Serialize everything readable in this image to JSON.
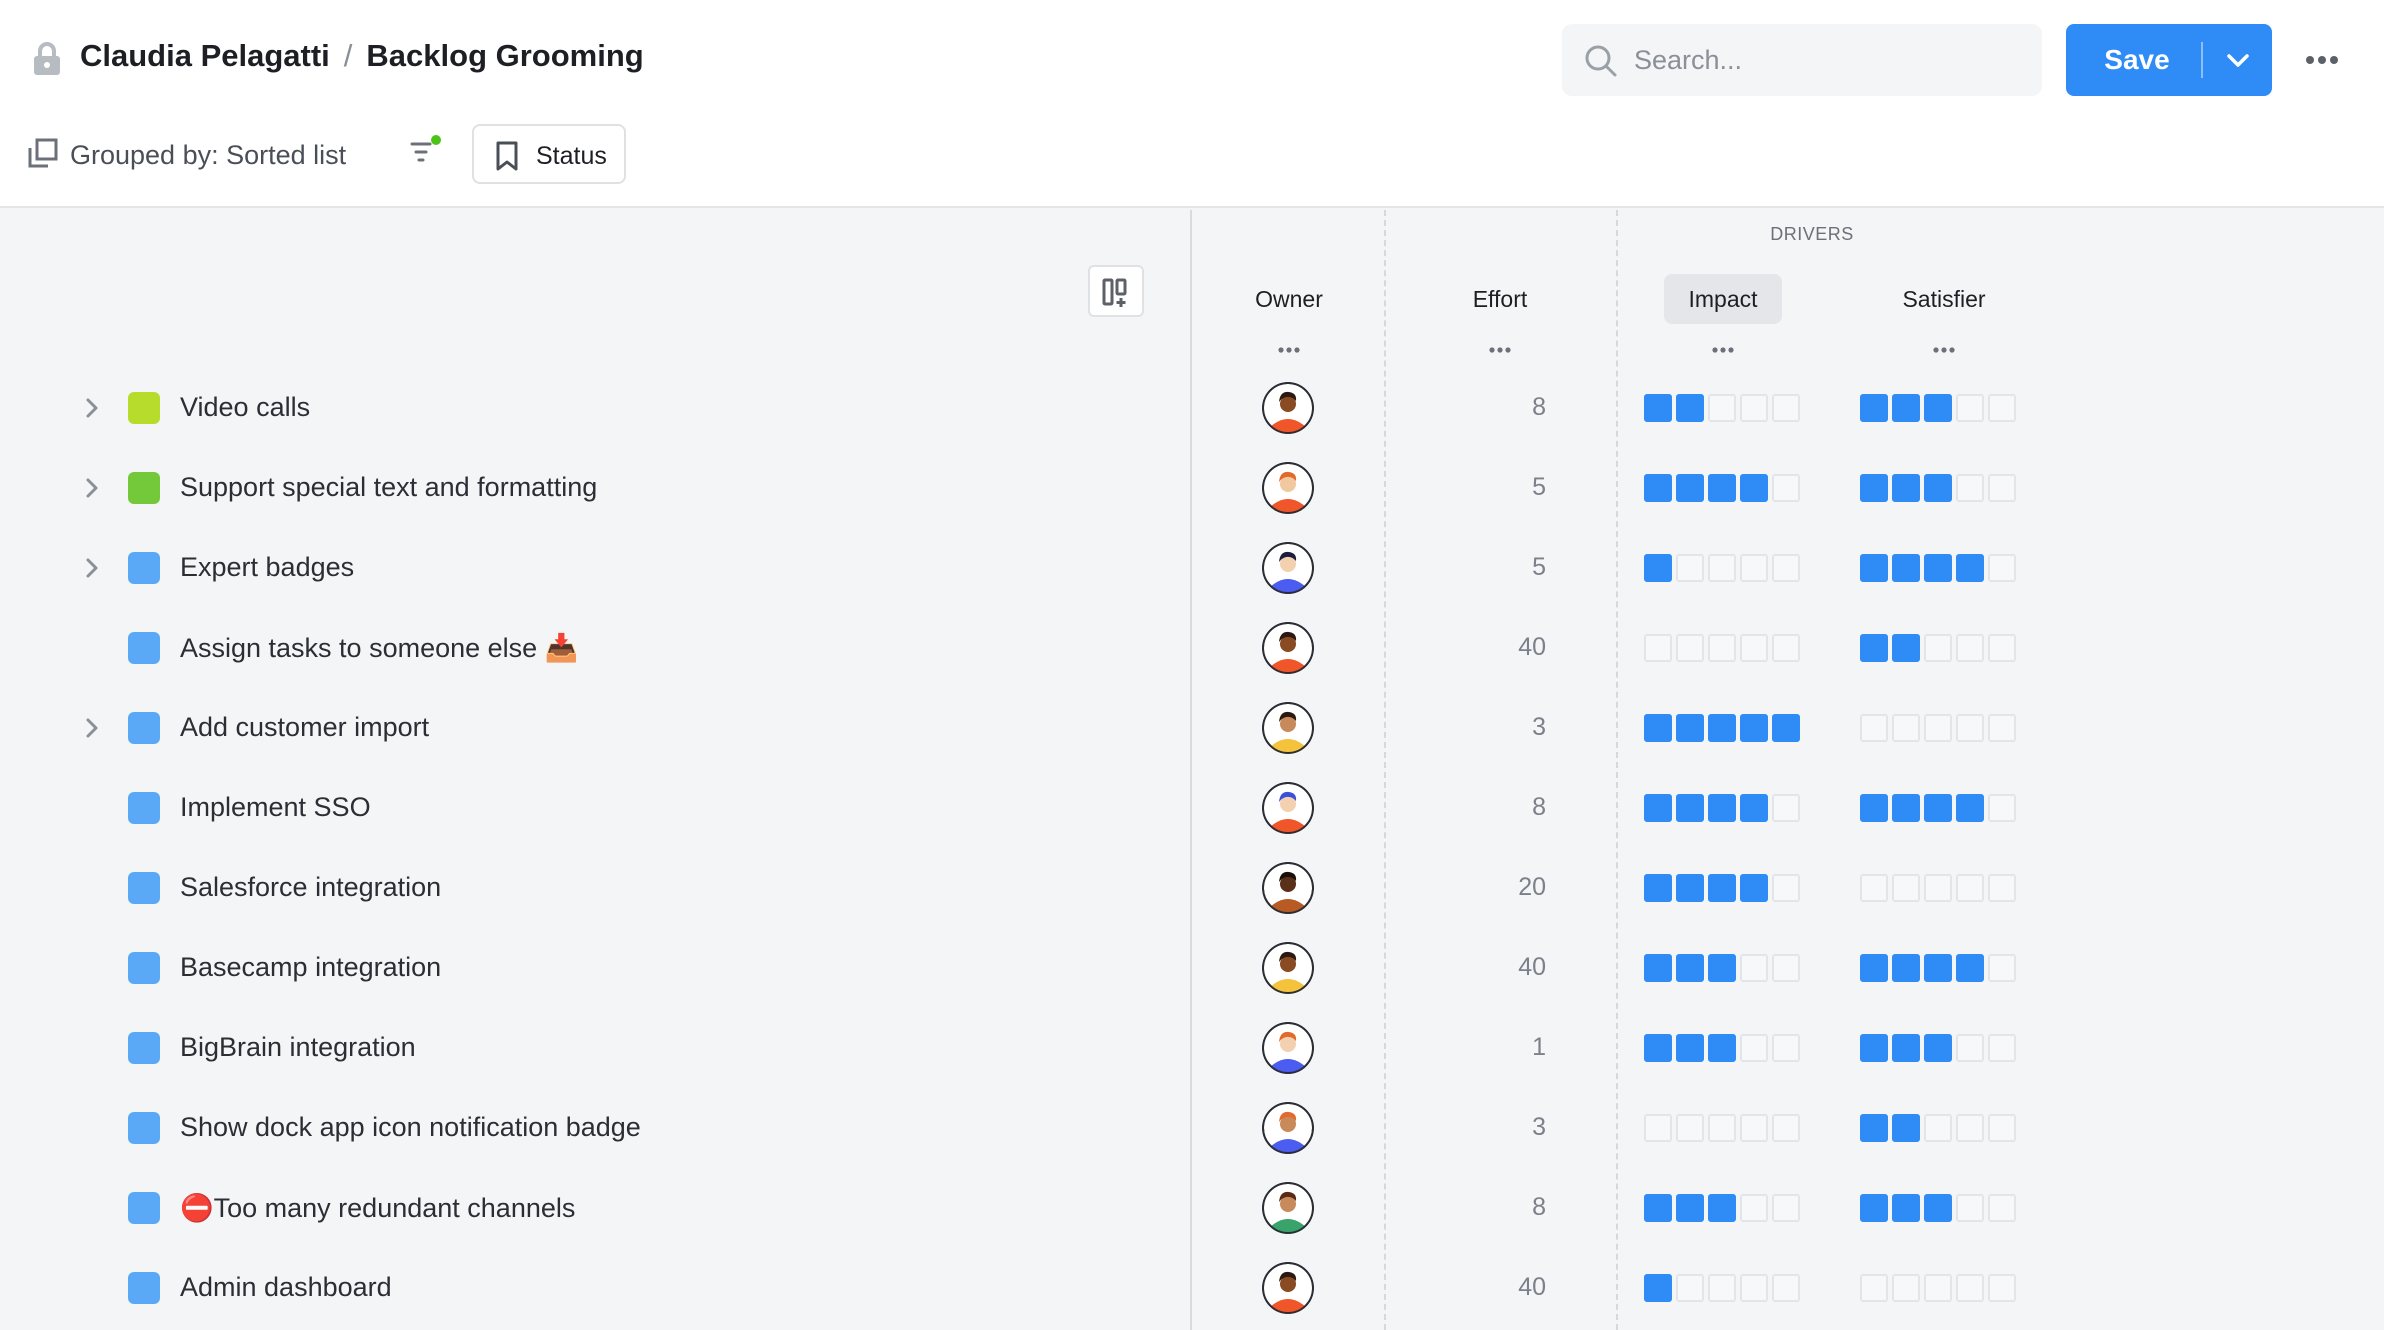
{
  "header": {
    "owner": "Claudia Pelagatti",
    "separator": "/",
    "view_name": "Backlog Grooming",
    "search_placeholder": "Search...",
    "save_label": "Save",
    "grouped_by": "Grouped by: Sorted list",
    "status_button": "Status"
  },
  "icons": {
    "lock": "lock-icon",
    "search": "search-icon",
    "save_menu": "chevron-down-icon",
    "more": "more-horizontal-icon",
    "grouping": "grouping-icon",
    "filter": "filter-icon",
    "bookmark": "bookmark-icon",
    "column_options": "column-options-icon"
  },
  "colors": {
    "accent": "#2f8cf6",
    "filter_indicator": "#4cc417",
    "lime": "#b7dc2b",
    "green": "#74c93a",
    "blue": "#5aa9f7"
  },
  "columns": {
    "drivers_group": "DRIVERS",
    "owner": "Owner",
    "effort": "Effort",
    "impact": "Impact",
    "satisfier": "Satisfier",
    "active_column": "Impact"
  },
  "rows": [
    {
      "title": "Video calls",
      "expandable": true,
      "color": "#b7dc2b",
      "effort": "8",
      "impact": 2,
      "satisfier": 3,
      "avatar": {
        "skin": "#8a4a22",
        "hair": "#2a1a12",
        "shirt": "#f0562a"
      }
    },
    {
      "title": "Support special text and formatting",
      "expandable": true,
      "color": "#74c93a",
      "effort": "5",
      "impact": 4,
      "satisfier": 3,
      "avatar": {
        "skin": "#f0c9a0",
        "hair": "#e26a2c",
        "shirt": "#f0562a"
      }
    },
    {
      "title": "Expert badges",
      "expandable": true,
      "color": "#5aa9f7",
      "effort": "5",
      "impact": 1,
      "satisfier": 4,
      "avatar": {
        "skin": "#f2d0b0",
        "hair": "#1d1f3a",
        "shirt": "#4b5cf0"
      }
    },
    {
      "title": "Assign tasks to someone else 📥",
      "expandable": false,
      "color": "#5aa9f7",
      "effort": "40",
      "impact": 0,
      "satisfier": 2,
      "avatar": {
        "skin": "#8a4a22",
        "hair": "#2a1a12",
        "shirt": "#f0562a"
      }
    },
    {
      "title": "Add customer import",
      "expandable": true,
      "color": "#5aa9f7",
      "effort": "3",
      "impact": 5,
      "satisfier": 0,
      "avatar": {
        "skin": "#c88a5a",
        "hair": "#2a1a12",
        "shirt": "#f5c33b"
      }
    },
    {
      "title": "Implement SSO",
      "expandable": false,
      "color": "#5aa9f7",
      "effort": "8",
      "impact": 4,
      "satisfier": 4,
      "avatar": {
        "skin": "#f2d0b0",
        "hair": "#3b4fd8",
        "shirt": "#f0562a"
      }
    },
    {
      "title": "Salesforce integration",
      "expandable": false,
      "color": "#5aa9f7",
      "effort": "20",
      "impact": 4,
      "satisfier": 0,
      "avatar": {
        "skin": "#5a3018",
        "hair": "#1a100a",
        "shirt": "#b85a24"
      }
    },
    {
      "title": "Basecamp integration",
      "expandable": false,
      "color": "#5aa9f7",
      "effort": "40",
      "impact": 3,
      "satisfier": 4,
      "avatar": {
        "skin": "#8a4a22",
        "hair": "#2a1a12",
        "shirt": "#f5c33b"
      }
    },
    {
      "title": "BigBrain integration",
      "expandable": false,
      "color": "#5aa9f7",
      "effort": "1",
      "impact": 3,
      "satisfier": 3,
      "avatar": {
        "skin": "#f2d0b0",
        "hair": "#e26a2c",
        "shirt": "#4b5cf0"
      }
    },
    {
      "title": "Show dock app icon notification badge",
      "expandable": false,
      "color": "#5aa9f7",
      "effort": "3",
      "impact": 0,
      "satisfier": 2,
      "avatar": {
        "skin": "#c88a5a",
        "hair": "#e26a2c",
        "shirt": "#4b5cf0"
      }
    },
    {
      "title": "⛔Too many redundant channels",
      "expandable": false,
      "color": "#5aa9f7",
      "effort": "8",
      "impact": 3,
      "satisfier": 3,
      "avatar": {
        "skin": "#c88a5a",
        "hair": "#5a2a14",
        "shirt": "#3aa36b"
      }
    },
    {
      "title": "Admin dashboard",
      "expandable": false,
      "color": "#5aa9f7",
      "effort": "40",
      "impact": 1,
      "satisfier": 0,
      "avatar": {
        "skin": "#8a4a22",
        "hair": "#2a1a12",
        "shirt": "#f0562a"
      }
    }
  ]
}
